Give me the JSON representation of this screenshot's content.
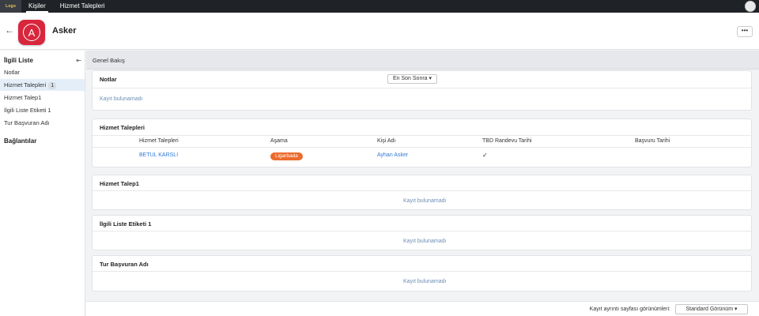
{
  "topbar": {
    "logo_text": "Logo",
    "tabs": [
      {
        "label": "Kişiler",
        "active": true
      },
      {
        "label": "Hizmet Talepleri",
        "active": false
      }
    ]
  },
  "header": {
    "title": "Asker",
    "avatar_letter": "A",
    "more_label": "•••",
    "avatar_color": "#d8263d"
  },
  "sidebar": {
    "related_heading": "İlgili Liste",
    "items": [
      {
        "label": "Notlar",
        "count": null,
        "active": false
      },
      {
        "label": "Hizmet Talepleri",
        "count": "1",
        "active": true
      },
      {
        "label": "Hizmet Talep1",
        "count": null,
        "active": false
      },
      {
        "label": "İlgili Liste Etiketi 1",
        "count": null,
        "active": false
      },
      {
        "label": "Tur Başvuran Adı",
        "count": null,
        "active": false
      }
    ],
    "links_heading": "Bağlantılar"
  },
  "main": {
    "overview_title": "Genel Bakış",
    "notes": {
      "title": "Notlar",
      "sort_label": "En Son Sonra ▾",
      "empty": "Kayıt bulunamadı"
    },
    "service_requests": {
      "title": "Hizmet Talepleri",
      "columns": [
        "Hizmet Talepleri",
        "Aşama",
        "Kişi Adı",
        "TBD Randevu Tarihi",
        "Başvuru Tarihi"
      ],
      "rows": [
        {
          "name": "BETUL KARSLI",
          "stage": "Ligarbada",
          "person": "Ayhan Asker",
          "tbd": "✓",
          "applied": ""
        }
      ],
      "stage_color": "#ec6b2d"
    },
    "talep1": {
      "title": "Hizmet Talep1",
      "empty": "Kayıt bulunamadı"
    },
    "tag_list": {
      "title": "İlgili Liste Etiketi 1",
      "empty": "Kayıt bulunamadı"
    },
    "applicant": {
      "title": "Tur Başvuran Adı",
      "empty": "Kayıt bulunamadı"
    },
    "footer": {
      "views_label": "Kayıt ayrıntı sayfası görünümleri:",
      "view_select": "Standard Görünüm ▾"
    }
  }
}
